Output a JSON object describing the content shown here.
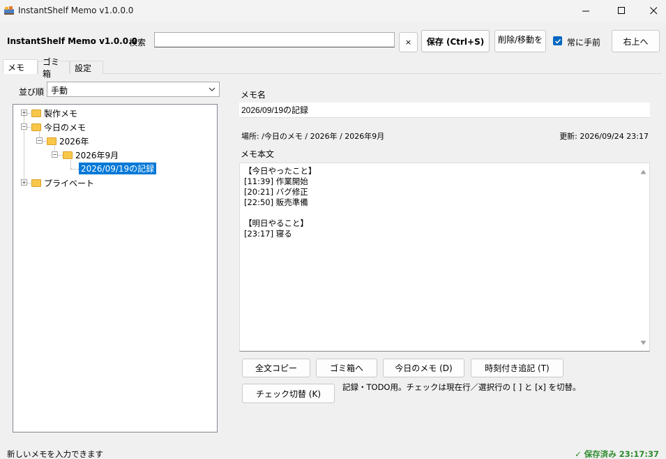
{
  "window": {
    "title": "InstantShelf Memo  v1.0.0.0",
    "minimize_glyph": "—",
    "maximize_glyph": "☐",
    "close_glyph": "✕"
  },
  "toolbar": {
    "app_name": "InstantShelf Memo  v1.0.0.0",
    "search_label": "検索",
    "search_value": "",
    "clear_label": "×",
    "save_label": "保存 (Ctrl+S)",
    "delete_move_label": "削除/移動を",
    "always_on_top_label": "常に手前",
    "always_on_top_checked": true,
    "top_right_label": "右上へ"
  },
  "tabs": [
    {
      "label": "メモ",
      "active": true
    },
    {
      "label": "ゴミ箱",
      "active": false
    },
    {
      "label": "設定",
      "active": false
    }
  ],
  "sort": {
    "label": "並び順",
    "value": "手動"
  },
  "tree": {
    "nodes": [
      {
        "label": "製作メモ",
        "expander": "+"
      },
      {
        "label": "今日のメモ",
        "expander": "−"
      },
      {
        "label": "2026年",
        "expander": "−"
      },
      {
        "label": "2026年9月",
        "expander": "−"
      },
      {
        "label": "2026/09/19の記録",
        "selected": true
      },
      {
        "label": "プライベート",
        "expander": "+"
      }
    ]
  },
  "editor": {
    "name_label": "メモ名",
    "name_value": "2026/09/19の記録",
    "location": "場所: /今日のメモ / 2026年 / 2026年9月",
    "updated": "更新: 2026/09/24 23:17",
    "body_label": "メモ本文",
    "body_lines": [
      "【今日やったこと】",
      "[11:39] 作業開始",
      "[20:21] バグ修正",
      "[22:50] 販売準備",
      "",
      "【明日やること】",
      "[23:17] 寝る"
    ]
  },
  "actions": {
    "copy_all": "全文コピー",
    "to_trash": "ゴミ箱へ",
    "today_memo": "今日のメモ (D)",
    "timestamp_append": "時刻付き追記 (T)",
    "toggle_check": "チェック切替 (K)",
    "hint": "記録・TODO用。チェックは現在行／選択行の [ ] と [x] を切替。"
  },
  "status": {
    "left": "新しいメモを入力できます",
    "right": "✓ 保存済み  23:17:37"
  },
  "colors": {
    "accent": "#0078d7",
    "saved": "#2e8b2e",
    "folder": "#f8c74a"
  }
}
